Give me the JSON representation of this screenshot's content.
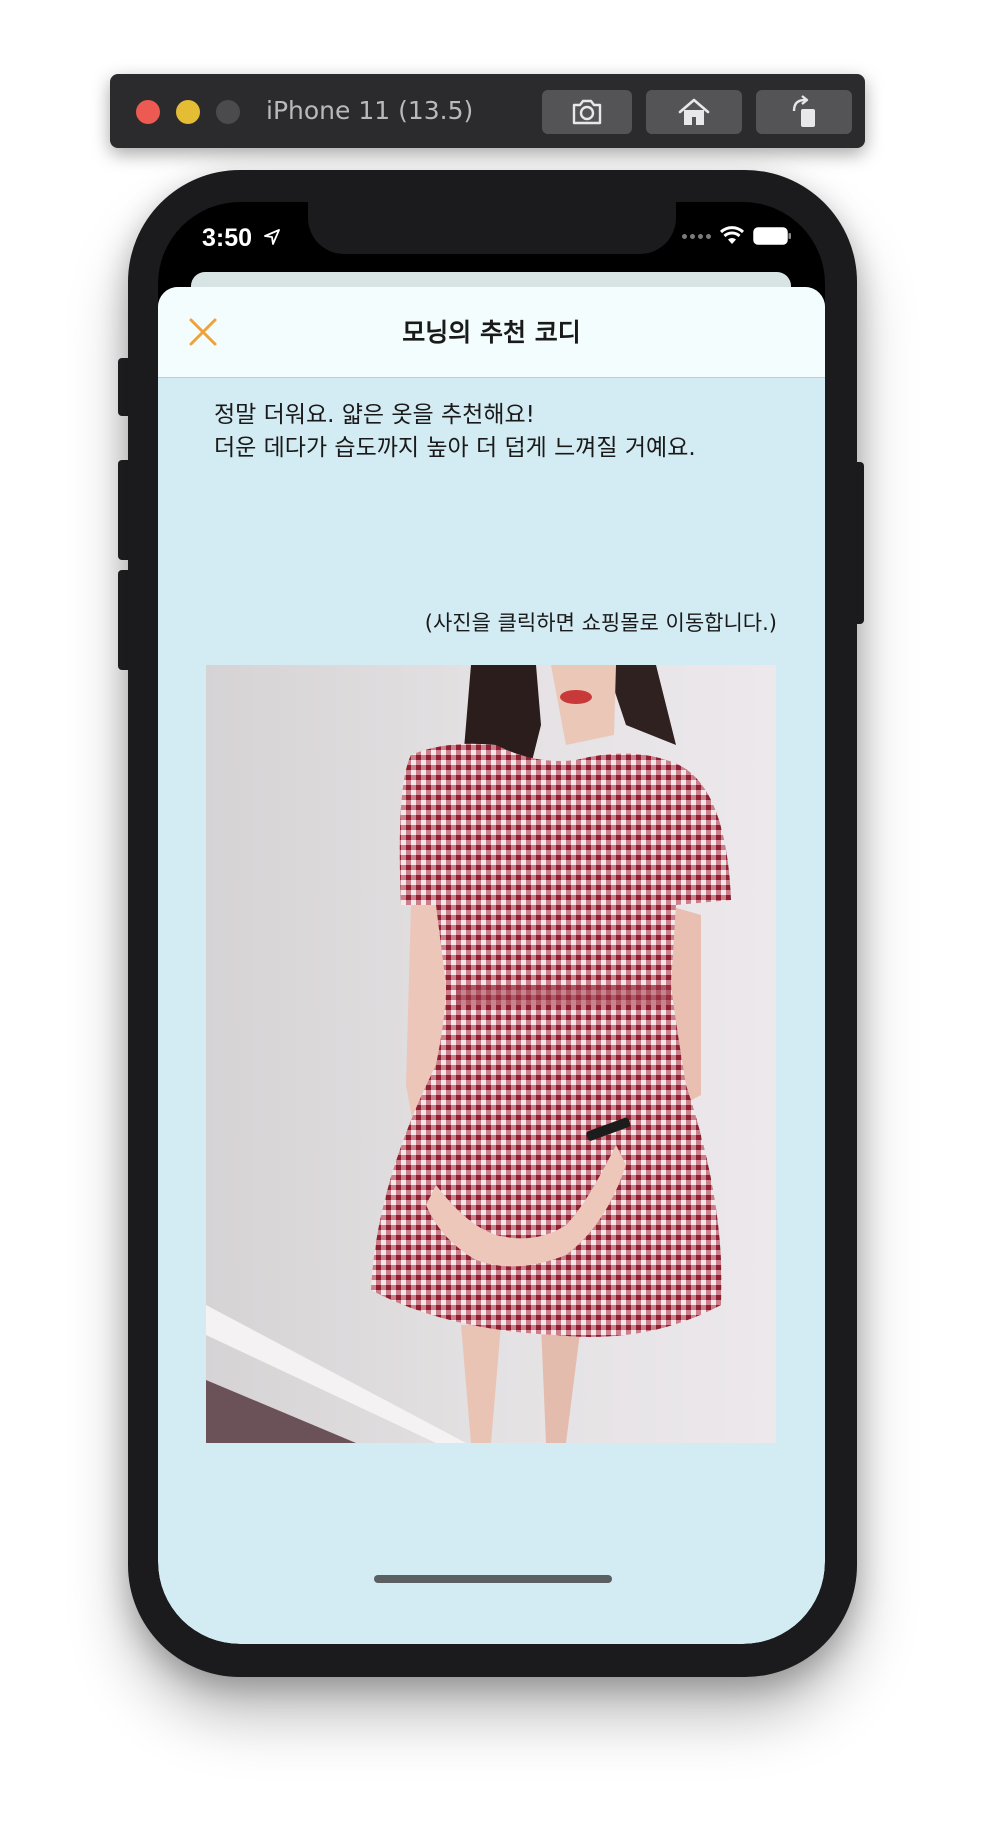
{
  "simulator": {
    "title": "iPhone 11 (13.5)",
    "buttons": [
      {
        "icon": "camera-icon"
      },
      {
        "icon": "home-icon"
      },
      {
        "icon": "rotate-icon"
      }
    ]
  },
  "status_bar": {
    "time": "3:50"
  },
  "nav": {
    "title": "모닝의 추천 코디",
    "close_icon": "close-icon",
    "accent_color": "#f0a23a"
  },
  "message": {
    "line1": "정말 더워요. 얇은 옷을 추천해요!",
    "line2": "더운 데다가 습도까지 높아 더 덥게 느껴질 거예요."
  },
  "hint": "(사진을 클릭하면 쇼핑몰로 이동합니다.)",
  "colors": {
    "background": "#d3ebf2",
    "nav_background": "#f3fdfd",
    "dress": "#b8434f"
  }
}
